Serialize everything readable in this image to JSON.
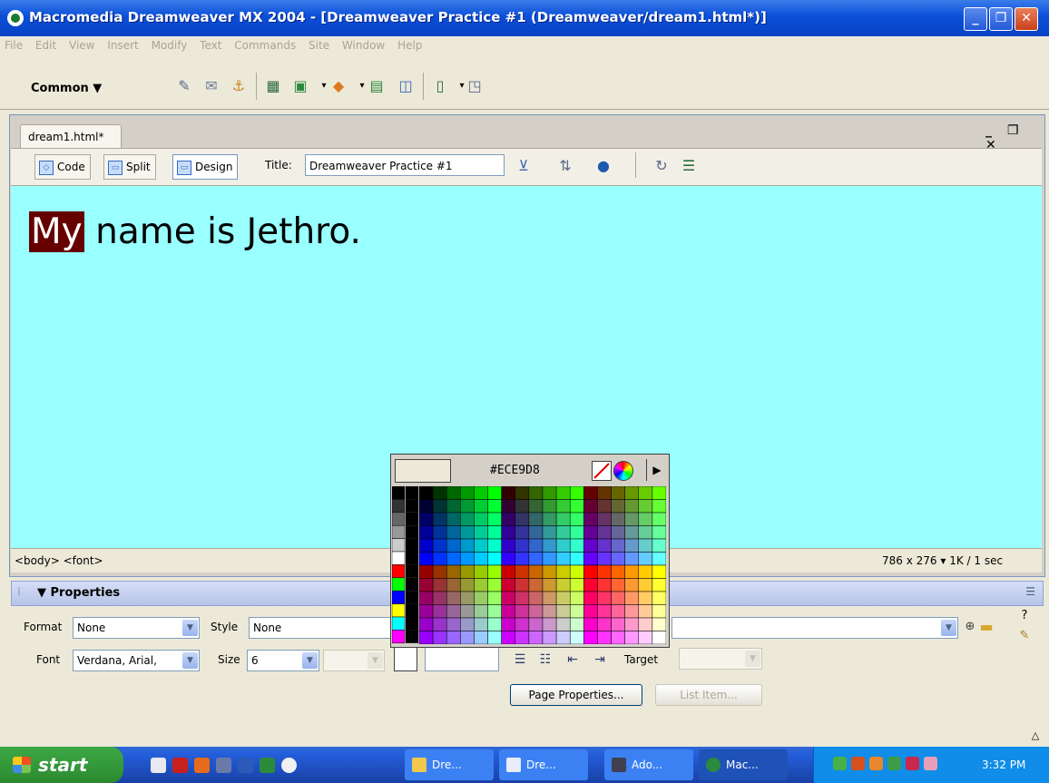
{
  "window": {
    "title": "Macromedia Dreamweaver MX 2004 - [Dreamweaver Practice #1 (Dreamweaver/dream1.html*)]"
  },
  "menu": [
    "File",
    "Edit",
    "View",
    "Insert",
    "Modify",
    "Text",
    "Commands",
    "Site",
    "Window",
    "Help"
  ],
  "insert_bar": {
    "category": "Common ▼"
  },
  "document": {
    "tab": "dream1.html*",
    "views": {
      "code": "Code",
      "split": "Split",
      "design": "Design"
    },
    "title_label": "Title:",
    "title_value": "Dreamweaver Practice #1",
    "content_selected": "My",
    "content_rest": " name is Jethro.",
    "tag_selector": "<body> <font>",
    "window_size": "786 x 276 ▾ 1K / 1 sec"
  },
  "color_picker": {
    "hex": "#ECE9D8",
    "swatch_color": "#ECE9D8"
  },
  "properties": {
    "header": "▼ Properties",
    "format_label": "Format",
    "format_value": "None",
    "style_label": "Style",
    "style_value": "None",
    "font_label": "Font",
    "font_value": "Verdana, Arial,",
    "size_label": "Size",
    "size_value": "6",
    "target_label": "Target",
    "page_properties": "Page Properties...",
    "list_item": "List Item..."
  },
  "taskbar": {
    "start": "start",
    "tasks": [
      "Dre...",
      "Dre...",
      "Ado...",
      "Mac..."
    ],
    "clock": "3:32 PM"
  },
  "colors": {
    "design_bg": "#99FFFF",
    "selection_bg": "#660000"
  }
}
